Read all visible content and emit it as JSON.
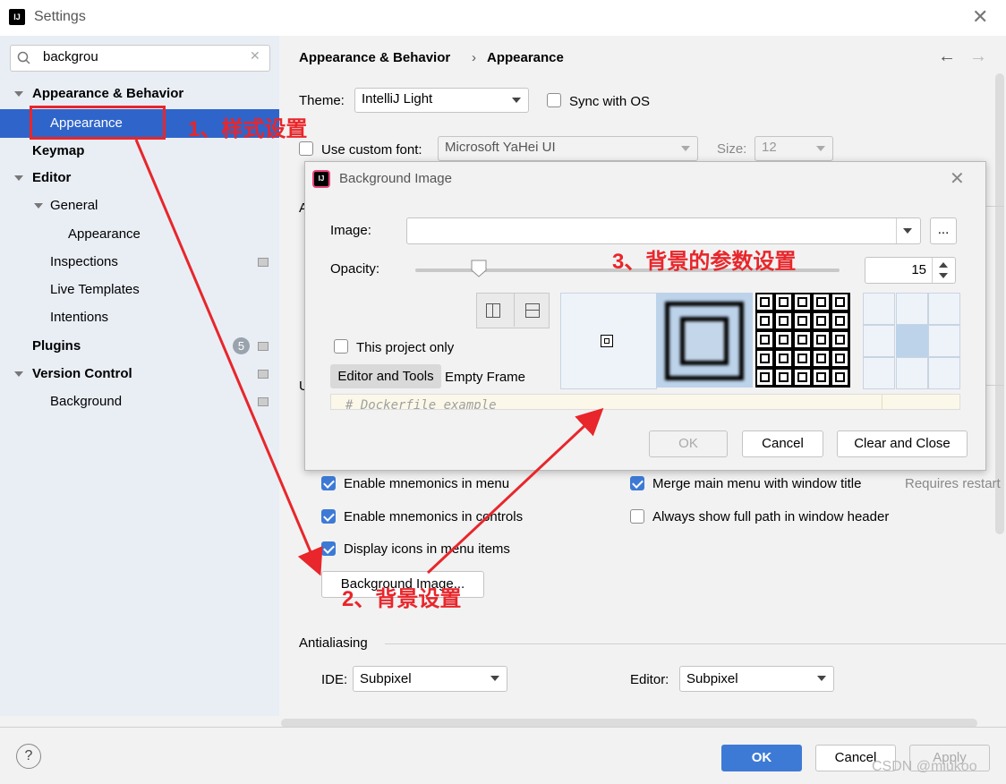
{
  "window": {
    "title": "Settings"
  },
  "search": {
    "value": "backgrou"
  },
  "sidebar": {
    "items": [
      {
        "label": "Appearance & Behavior"
      },
      {
        "label": "Appearance"
      },
      {
        "label": "Keymap"
      },
      {
        "label": "Editor"
      },
      {
        "label": "General"
      },
      {
        "label": "Appearance"
      },
      {
        "label": "Inspections"
      },
      {
        "label": "Live Templates"
      },
      {
        "label": "Intentions"
      },
      {
        "label": "Plugins",
        "badge": "5"
      },
      {
        "label": "Version Control"
      },
      {
        "label": "Background"
      }
    ]
  },
  "breadcrumb": {
    "parent": "Appearance & Behavior",
    "separator": "›",
    "current": "Appearance"
  },
  "theme": {
    "label": "Theme:",
    "value": "IntelliJ Light",
    "sync_label": "Sync with OS"
  },
  "font": {
    "custom_label": "Use custom font:",
    "value": "Microsoft YaHei UI",
    "size_label": "Size:",
    "size_value": "12"
  },
  "section_letters": {
    "a": "A",
    "u": "U"
  },
  "options": {
    "mnemonics_menu": "Enable mnemonics in menu",
    "mnemonics_controls": "Enable mnemonics in controls",
    "display_icons": "Display icons in menu items",
    "merge_menu": "Merge main menu with window title",
    "requires_restart": "Requires restart",
    "full_path": "Always show full path in window header",
    "background_button": "Background Image..."
  },
  "antialiasing": {
    "title": "Antialiasing",
    "ide_label": "IDE:",
    "ide_value": "Subpixel",
    "editor_label": "Editor:",
    "editor_value": "Subpixel"
  },
  "dialog": {
    "title": "Background Image",
    "image_label": "Image:",
    "browse_label": "...",
    "opacity_label": "Opacity:",
    "opacity_value": "15",
    "opacity_fraction": 0.15,
    "this_project_only": "This project only",
    "tab_editor_tools": "Editor and Tools",
    "tab_empty_frame": "Empty Frame",
    "preview_text": "# Dockerfile example",
    "ok": "OK",
    "cancel": "Cancel",
    "clear_close": "Clear and Close"
  },
  "footer": {
    "help": "?",
    "ok": "OK",
    "cancel": "Cancel",
    "apply": "Apply"
  },
  "annotations": {
    "step1": "1、样式设置",
    "step2": "2、背景设置",
    "step3": "3、背景的参数设置",
    "watermark": "CSDN @miukoo"
  },
  "colors": {
    "accent": "#3d7ad6",
    "selection": "#2f65ca",
    "annotation": "#e8262b",
    "badge": "#9aa3ad"
  }
}
